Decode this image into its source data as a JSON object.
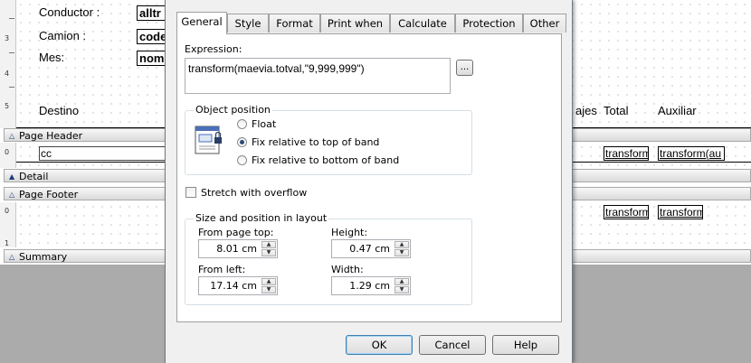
{
  "designer": {
    "ruler_numbers": [
      "3",
      "4",
      "5",
      "0",
      "0",
      "1"
    ],
    "header_labels": [
      "Conductor :",
      "Camion :",
      "Mes:"
    ],
    "header_fields": [
      "alltr",
      "code",
      "nom"
    ],
    "column_headers": [
      "Destino",
      "ajes",
      "Total",
      "Auxiliar"
    ],
    "detail_fields": [
      "cc",
      "transform",
      "transform(au"
    ],
    "footer_fields": [
      "transform",
      "transform"
    ],
    "bands": {
      "page_header": "Page Header",
      "detail": "Detail",
      "page_footer": "Page Footer",
      "summary": "Summary"
    }
  },
  "dialog": {
    "tabs": [
      "General",
      "Style",
      "Format",
      "Print when",
      "Calculate",
      "Protection",
      "Other"
    ],
    "active_tab": "General",
    "expression_label": "Expression:",
    "expression_value": "transform(maevia.totval,\"9,999,999\")",
    "ellipsis_button": "...",
    "object_position": {
      "title": "Object position",
      "options": [
        "Float",
        "Fix relative to top of band",
        "Fix relative to bottom of band"
      ],
      "selected": "Fix relative to top of band"
    },
    "stretch_label": "Stretch with overflow",
    "stretch_checked": false,
    "size_position": {
      "title": "Size and position in layout",
      "from_page_top_label": "From page top:",
      "from_page_top_value": "8.01 cm",
      "height_label": "Height:",
      "height_value": "0.47 cm",
      "from_left_label": "From left:",
      "from_left_value": "17.14 cm",
      "width_label": "Width:",
      "width_value": "1.29 cm"
    },
    "buttons": {
      "ok": "OK",
      "cancel": "Cancel",
      "help": "Help"
    }
  }
}
